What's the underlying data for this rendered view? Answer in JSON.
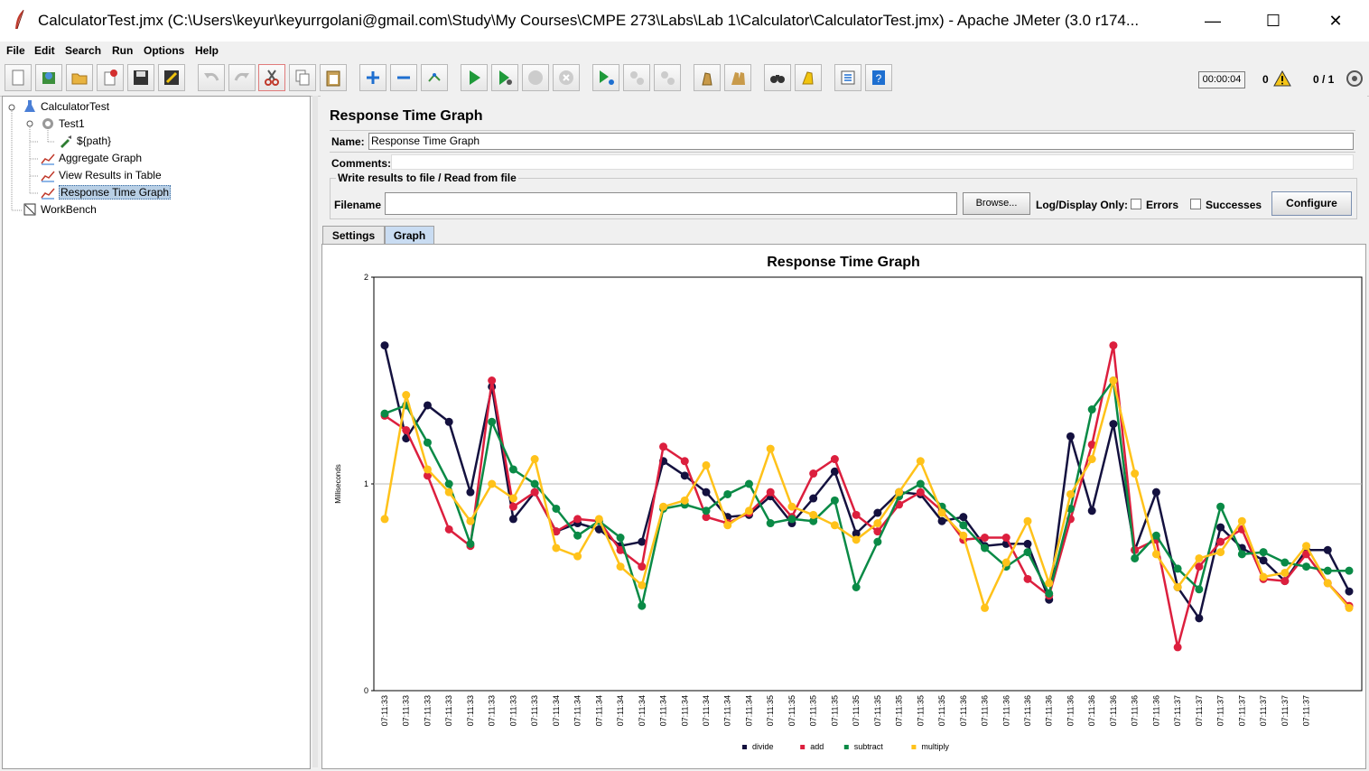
{
  "window": {
    "title": "CalculatorTest.jmx (C:\\Users\\keyur\\keyurrgolani@gmail.com\\Study\\My Courses\\CMPE 273\\Labs\\Lab 1\\Calculator\\CalculatorTest.jmx) - Apache JMeter (3.0 r174...",
    "minimize": "—",
    "maximize": "☐",
    "close": "✕"
  },
  "menu": {
    "file": "File",
    "edit": "Edit",
    "search": "Search",
    "run": "Run",
    "options": "Options",
    "help": "Help"
  },
  "toolbar": {
    "timer": "00:00:04",
    "errors": "0",
    "threads": "0 / 1"
  },
  "tree": {
    "root": "CalculatorTest",
    "test": "Test1",
    "sampler": "${path}",
    "aggregate": "Aggregate Graph",
    "results": "View Results in Table",
    "rtg": "Response Time Graph",
    "workbench": "WorkBench"
  },
  "panel": {
    "title": "Response Time Graph",
    "name_label": "Name:",
    "name_value": "Response Time Graph",
    "comments_label": "Comments:",
    "group_title": "Write results to file / Read from file",
    "filename_label": "Filename",
    "browse": "Browse...",
    "log_only": "Log/Display Only:",
    "errors": "Errors",
    "successes": "Successes",
    "configure": "Configure",
    "tab_settings": "Settings",
    "tab_graph": "Graph"
  },
  "colors": {
    "divide": "#14113f",
    "add": "#dc1f3e",
    "subtract": "#0a8a46",
    "multiply": "#ffc21a"
  },
  "chart_data": {
    "type": "line",
    "title": "Response Time Graph",
    "ylabel": "Milliseconds",
    "xlabel": "",
    "ylim": [
      0,
      2
    ],
    "yticks": [
      "0",
      "1",
      "2"
    ],
    "grid": "horizontal at 1",
    "legend": "bottom",
    "categories": [
      "07:11:33",
      "07:11:33",
      "07:11:33",
      "07:11:33",
      "07:11:33",
      "07:11:33",
      "07:11:33",
      "07:11:33",
      "07:11:34",
      "07:11:34",
      "07:11:34",
      "07:11:34",
      "07:11:34",
      "07:11:34",
      "07:11:34",
      "07:11:34",
      "07:11:34",
      "07:11:34",
      "07:11:35",
      "07:11:35",
      "07:11:35",
      "07:11:35",
      "07:11:35",
      "07:11:35",
      "07:11:35",
      "07:11:35",
      "07:11:35",
      "07:11:36",
      "07:11:36",
      "07:11:36",
      "07:11:36",
      "07:11:36",
      "07:11:36",
      "07:11:36",
      "07:11:36",
      "07:11:36",
      "07:11:36",
      "07:11:37",
      "07:11:37",
      "07:11:37",
      "07:11:37",
      "07:11:37",
      "07:11:37",
      "07:11:37"
    ],
    "series": [
      {
        "name": "divide",
        "values": [
          1.67,
          1.22,
          1.38,
          1.3,
          0.96,
          1.47,
          0.83,
          0.96,
          0.77,
          0.81,
          0.78,
          0.7,
          0.72,
          1.11,
          1.04,
          0.96,
          0.84,
          0.85,
          0.94,
          0.81,
          0.93,
          1.06,
          0.76,
          0.86,
          0.96,
          0.95,
          0.82,
          0.84,
          0.7,
          0.71,
          0.71,
          0.44,
          1.23,
          0.87,
          1.29,
          0.68,
          0.96,
          0.5,
          0.35,
          0.79,
          0.69,
          0.63,
          0.53,
          0.68,
          0.68,
          0.48
        ]
      },
      {
        "name": "add",
        "values": [
          1.33,
          1.26,
          1.04,
          0.78,
          0.7,
          1.5,
          0.89,
          0.96,
          0.77,
          0.83,
          0.82,
          0.68,
          0.6,
          1.18,
          1.11,
          0.84,
          0.81,
          0.86,
          0.96,
          0.84,
          1.05,
          1.12,
          0.85,
          0.77,
          0.9,
          0.96,
          0.87,
          0.73,
          0.74,
          0.74,
          0.54,
          0.46,
          0.83,
          1.19,
          1.67,
          0.68,
          0.73,
          0.21,
          0.6,
          0.72,
          0.78,
          0.54,
          0.53,
          0.66,
          0.52,
          0.41
        ]
      },
      {
        "name": "subtract",
        "values": [
          1.34,
          1.38,
          1.2,
          1.0,
          0.71,
          1.3,
          1.07,
          1.0,
          0.88,
          0.75,
          0.82,
          0.74,
          0.41,
          0.88,
          0.9,
          0.87,
          0.95,
          1.0,
          0.81,
          0.83,
          0.82,
          0.92,
          0.5,
          0.72,
          0.94,
          1.0,
          0.89,
          0.8,
          0.69,
          0.6,
          0.67,
          0.47,
          0.88,
          1.36,
          1.5,
          0.64,
          0.75,
          0.59,
          0.49,
          0.89,
          0.66,
          0.67,
          0.62,
          0.6,
          0.58,
          0.58
        ]
      },
      {
        "name": "multiply",
        "values": [
          0.83,
          1.43,
          1.07,
          0.96,
          0.82,
          1.0,
          0.93,
          1.12,
          0.69,
          0.65,
          0.83,
          0.6,
          0.51,
          0.89,
          0.92,
          1.09,
          0.8,
          0.87,
          1.17,
          0.89,
          0.85,
          0.8,
          0.73,
          0.81,
          0.96,
          1.11,
          0.86,
          0.75,
          0.4,
          0.62,
          0.82,
          0.52,
          0.95,
          1.12,
          1.5,
          1.05,
          0.66,
          0.5,
          0.64,
          0.67,
          0.82,
          0.55,
          0.57,
          0.7,
          0.52,
          0.4
        ]
      }
    ]
  }
}
